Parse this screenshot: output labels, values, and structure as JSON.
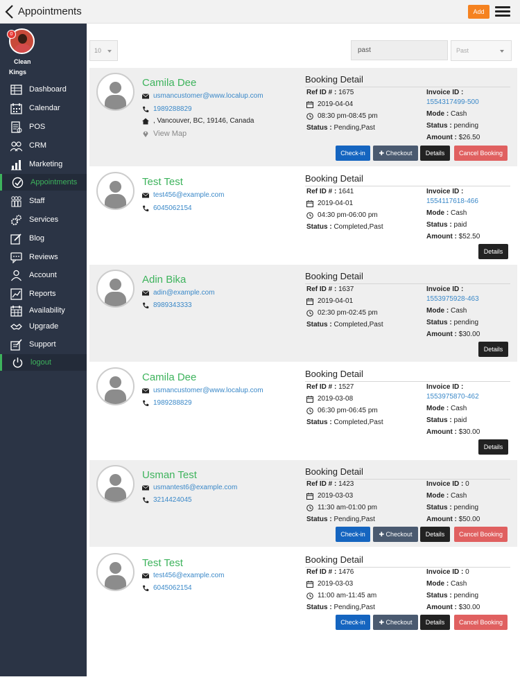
{
  "header": {
    "title": "Appointments",
    "add_label": "Add"
  },
  "sidebar": {
    "badge": "0",
    "brand_line1": "Clean",
    "brand_line2": "Kings",
    "items": [
      {
        "label": "Dashboard",
        "icon": "dashboard-icon"
      },
      {
        "label": "Calendar",
        "icon": "calendar-icon"
      },
      {
        "label": "POS",
        "icon": "pos-icon"
      },
      {
        "label": "CRM",
        "icon": "crm-icon"
      },
      {
        "label": "Marketing",
        "icon": "marketing-icon"
      },
      {
        "label": "Appointments",
        "icon": "check-circle-icon"
      },
      {
        "label": "Staff",
        "icon": "staff-icon"
      },
      {
        "label": "Services",
        "icon": "services-icon"
      },
      {
        "label": "Blog",
        "icon": "blog-icon"
      },
      {
        "label": "Reviews",
        "icon": "reviews-icon"
      },
      {
        "label": "Account",
        "icon": "account-icon"
      },
      {
        "label": "Reports",
        "icon": "reports-icon"
      },
      {
        "label": "Availability",
        "icon": "availability-icon"
      },
      {
        "label": "Upgrade",
        "icon": "upgrade-icon"
      },
      {
        "label": "Support",
        "icon": "support-icon"
      },
      {
        "label": "logout",
        "icon": "power-icon"
      }
    ],
    "active_color": "#3db35c"
  },
  "filters": {
    "page_size": "10",
    "search_value": "past",
    "status_placeholder": "Past"
  },
  "labels": {
    "booking_detail": "Booking Detail",
    "ref_id": "Ref ID # :",
    "status": "Status :",
    "invoice_id": "Invoice ID :",
    "mode": "Mode :",
    "amount": "Amount :",
    "view_map": "View Map",
    "checkin": "Check-in",
    "checkout": "Checkout",
    "details": "Details",
    "cancel": "Cancel Booking"
  },
  "appointments": [
    {
      "name": "Camila Dee",
      "email": "usmancustomer@www.localup.com",
      "phone": "1989288829",
      "address": ",  Vancouver,  BC,  19146,  Canada",
      "ref": "1675",
      "date": "2019-04-04",
      "time": "08:30 pm-08:45 pm",
      "status": "Pending,Past",
      "invoice": "1554317499-500",
      "mode": "Cash",
      "pay_status": "pending",
      "amount": "$26.50"
    },
    {
      "name": "Test Test",
      "email": "test456@example.com",
      "phone": "6045062154",
      "ref": "1641",
      "date": "2019-04-01",
      "time": "04:30 pm-06:00 pm",
      "status": "Completed,Past",
      "invoice": "1554117618-466",
      "mode": "Cash",
      "pay_status": "paid",
      "amount": "$52.50"
    },
    {
      "name": "Adin Bika",
      "email": "adin@example.com",
      "phone": "8989343333",
      "ref": "1637",
      "date": "2019-04-01",
      "time": "02:30 pm-02:45 pm",
      "status": "Completed,Past",
      "invoice": "1553975928-463",
      "mode": "Cash",
      "pay_status": "pending",
      "amount": "$30.00"
    },
    {
      "name": "Camila Dee",
      "email": "usmancustomer@www.localup.com",
      "phone": "1989288829",
      "ref": "1527",
      "date": "2019-03-08",
      "time": "06:30 pm-06:45 pm",
      "status": "Completed,Past",
      "invoice": "1553975870-462",
      "mode": "Cash",
      "pay_status": "paid",
      "amount": "$30.00"
    },
    {
      "name": "Usman Test",
      "email": "usmantest6@example.com",
      "phone": "3214424045",
      "ref": "1423",
      "date": "2019-03-03",
      "time": "11:30 am-01:00 pm",
      "status": "Pending,Past",
      "invoice": "0",
      "mode": "Cash",
      "pay_status": "pending",
      "amount": "$50.00"
    },
    {
      "name": "Test Test",
      "email": "test456@example.com",
      "phone": "6045062154",
      "ref": "1476",
      "date": "2019-03-03",
      "time": "11:00 am-11:45 am",
      "status": "Pending,Past",
      "invoice": "0",
      "mode": "Cash",
      "pay_status": "pending",
      "amount": "$30.00"
    }
  ]
}
